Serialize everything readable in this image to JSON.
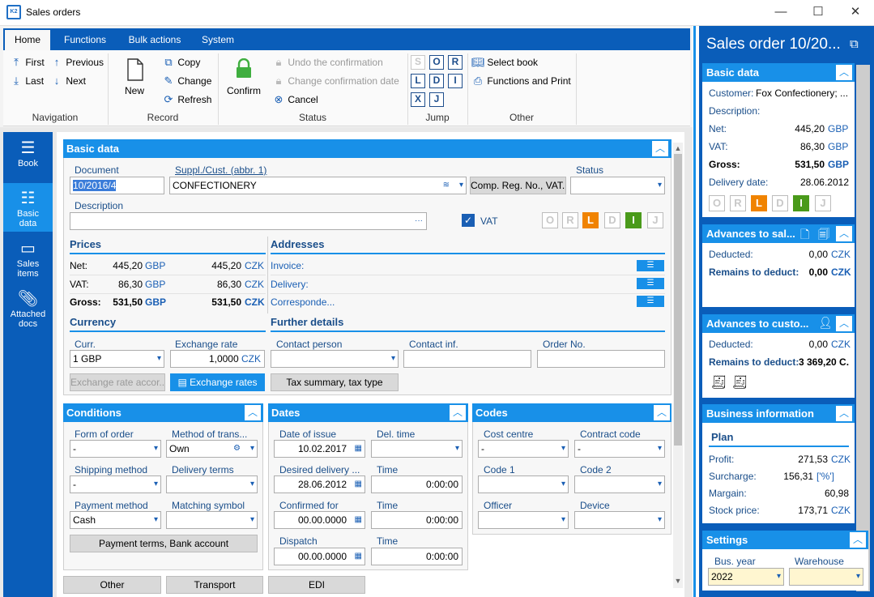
{
  "window": {
    "title": "Sales orders",
    "minimize": "—",
    "maximize": "☐",
    "close": "✕",
    "app_icon_text": "K2"
  },
  "ribbon": {
    "tabs": [
      "Home",
      "Functions",
      "Bulk actions",
      "System"
    ],
    "navigation": {
      "first": "First",
      "previous": "Previous",
      "last": "Last",
      "next": "Next",
      "label": "Navigation"
    },
    "record": {
      "new": "New",
      "copy": "Copy",
      "change": "Change",
      "refresh": "Refresh",
      "label": "Record"
    },
    "status": {
      "confirm": "Confirm",
      "undo": "Undo the confirmation",
      "change_date": "Change confirmation date",
      "cancel": "Cancel",
      "label": "Status"
    },
    "jump": {
      "keys": [
        "S",
        "O",
        "R",
        "L",
        "D",
        "I",
        "X",
        "J"
      ],
      "label": "Jump"
    },
    "other": {
      "select_book": "Select book",
      "functions_print": "Functions and Print",
      "label": "Other"
    }
  },
  "nav": {
    "book": "Book",
    "basic_data": "Basic data",
    "sales_items": "Sales items",
    "attached_docs": "Attached docs"
  },
  "basic": {
    "header": "Basic data",
    "document_label": "Document",
    "document_value": "10/2016/4",
    "supplcust_label": "Suppl./Cust. (abbr. 1)",
    "supplcust_value": "CONFECTIONERY",
    "comp_reg_button": "Comp. Reg. No., VAT...",
    "status_label": "Status",
    "status_value": "",
    "description_label": "Description",
    "description_value": "",
    "vat_label": "VAT",
    "status_letters": [
      "O",
      "R",
      "L",
      "D",
      "I",
      "J"
    ]
  },
  "prices": {
    "header": "Prices",
    "rows": [
      {
        "label": "Net:",
        "gbp": "445,20",
        "czk": "445,20",
        "bold": false
      },
      {
        "label": "VAT:",
        "gbp": "86,30",
        "czk": "86,30",
        "bold": false
      },
      {
        "label": "Gross:",
        "gbp": "531,50",
        "czk": "531,50",
        "bold": true
      }
    ],
    "cur1": "GBP",
    "cur2": "CZK"
  },
  "addresses": {
    "header": "Addresses",
    "invoice": "Invoice:",
    "delivery": "Delivery:",
    "correspondence": "Corresponde..."
  },
  "currency": {
    "header": "Currency",
    "curr_label": "Curr.",
    "curr_value": "1 GBP",
    "rate_label": "Exchange rate",
    "rate_value": "1,0000",
    "rate_cur": "CZK",
    "rate_acc_button": "Exchange rate accor...",
    "exchange_rates_button": "Exchange rates"
  },
  "further": {
    "header": "Further details",
    "contact_person": "Contact person",
    "contact_inf": "Contact inf.",
    "order_no": "Order No.",
    "tax_button": "Tax summary, tax type"
  },
  "conditions": {
    "header": "Conditions",
    "form_label": "Form of order",
    "form_value": "-",
    "method_label": "Method of trans...",
    "method_value": "Own",
    "shipping_label": "Shipping method",
    "shipping_value": "-",
    "delivery_terms_label": "Delivery terms",
    "delivery_terms_value": "",
    "payment_label": "Payment method",
    "payment_value": "Cash",
    "matching_label": "Matching symbol",
    "matching_value": "",
    "terms_button": "Payment terms, Bank account"
  },
  "dates": {
    "header": "Dates",
    "issue_label": "Date of issue",
    "issue_value": "10.02.2017",
    "deltime_label": "Del. time",
    "deltime_value": "",
    "desired_label": "Desired delivery ...",
    "desired_value": "28.06.2012",
    "time_label": "Time",
    "time1": "0:00:00",
    "confirmed_label": "Confirmed for",
    "confirmed_value": "00.00.0000",
    "time2": "0:00:00",
    "dispatch_label": "Dispatch",
    "dispatch_value": "00.00.0000",
    "time3": "0:00:00"
  },
  "codes": {
    "header": "Codes",
    "cost_label": "Cost centre",
    "cost_value": "-",
    "contract_label": "Contract code",
    "contract_value": "-",
    "code1_label": "Code 1",
    "code2_label": "Code 2",
    "officer_label": "Officer",
    "device_label": "Device"
  },
  "bottom_buttons": [
    "Other",
    "Transport",
    "EDI"
  ],
  "right": {
    "title": "Sales order 10/20...",
    "basic": {
      "header": "Basic data",
      "customer_label": "Customer:",
      "customer_value": "Fox Confectionery; ...",
      "description_label": "Description:",
      "net_label": "Net:",
      "net_value": "445,20",
      "net_cur": "GBP",
      "vat_label": "VAT:",
      "vat_value": "86,30",
      "vat_cur": "GBP",
      "gross_label": "Gross:",
      "gross_value": "531,50",
      "gross_cur": "GBP",
      "delivery_label": "Delivery date:",
      "delivery_value": "28.06.2012",
      "letters": [
        "O",
        "R",
        "L",
        "D",
        "I",
        "J"
      ]
    },
    "advances_sales": {
      "header": "Advances to sal...",
      "deducted_label": "Deducted:",
      "deducted_value": "0,00",
      "deducted_cur": "CZK",
      "remains_label": "Remains to deduct:",
      "remains_value": "0,00",
      "remains_cur": "CZK"
    },
    "advances_cust": {
      "header": "Advances to custo...",
      "deducted_label": "Deducted:",
      "deducted_value": "0,00",
      "deducted_cur": "CZK",
      "remains_label": "Remains to deduct:",
      "remains_value": "3 369,20 C."
    },
    "business": {
      "header": "Business information",
      "plan": "Plan",
      "profit_label": "Profit:",
      "profit_value": "271,53",
      "profit_cur": "CZK",
      "surcharge_label": "Surcharge:",
      "surcharge_value": "156,31",
      "surcharge_unit": "['%']",
      "margin_label": "Margain:",
      "margin_value": "60,98",
      "stock_label": "Stock price:",
      "stock_value": "173,71",
      "stock_cur": "CZK"
    },
    "settings": {
      "header": "Settings",
      "year_label": "Bus. year",
      "year_value": "2022",
      "warehouse_label": "Warehouse",
      "warehouse_value": ""
    }
  }
}
